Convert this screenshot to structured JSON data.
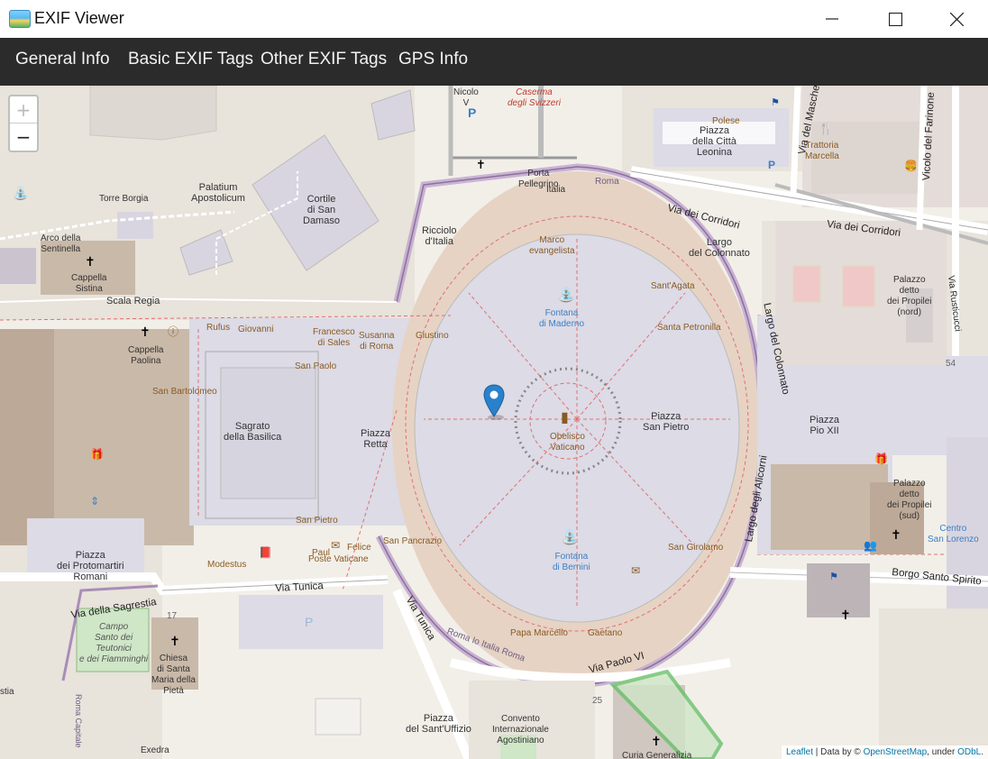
{
  "window": {
    "title": "EXIF Viewer",
    "minimize_label": "",
    "maximize_label": "",
    "close_label": ""
  },
  "tabs": [
    {
      "label": "General Info"
    },
    {
      "label": "Basic EXIF Tags"
    },
    {
      "label": "Other EXIF Tags"
    },
    {
      "label": "GPS Info"
    }
  ],
  "map": {
    "zoom_in": "+",
    "zoom_out": "−",
    "attribution": {
      "leaflet": "Leaflet",
      "sep": " | Data by © ",
      "osm": "OpenStreetMap",
      "under": ", under ",
      "license": "ODbL",
      "end": "."
    },
    "labels": {
      "nicolo": "Nicolo\nV",
      "caserma": "Caserma\ndegli Svizzeri",
      "porta": "Porta\nPellegrino",
      "italia_top": "Italia",
      "roma_top": "Roma",
      "torre_borgia": "Torre Borgia",
      "palatium": "Palatium\nApostolicum",
      "cortile": "Cortile\ndi San\nDamaso",
      "arco": "Arco della\nSentinella",
      "cappella_sistina": "Cappella\nSistina",
      "scala_regia": "Scala Regia",
      "ricciolo": "Ricciolo\nd'Italia",
      "marco": "Marco\nevangelista",
      "santagata": "Sant'Agata",
      "santa_petronilla": "Santa Petronilla",
      "fontana_maderno": "Fontana\ndi Maderno",
      "rufus": "Rufus",
      "giovanni": "Giovanni",
      "francesco": "Francesco\ndi Sales",
      "susanna": "Susanna\ndi Roma",
      "giustino": "Giustino",
      "cappella_paolina": "Cappella\nPaolina",
      "san_paolo": "San Paolo",
      "san_bartolomeo": "San Bartolomeo",
      "sagrato": "Sagrato\ndella Basilica",
      "piazza_retta": "Piazza\nRetta",
      "obelisco": "Obelisco\nVaticano",
      "piazza_san_pietro": "Piazza\nSan Pietro",
      "piazza_pio": "Piazza\nPio XII",
      "san_pietro_lower": "San Pietro",
      "piazza_protomartiri": "Piazza\ndei Protomartiri\nRomani",
      "modestus": "Modestus",
      "paul": "Paul",
      "poste": "Poste Vaticane",
      "felice": "Felice",
      "san_pancrazio": "San Pancrazio",
      "fontana_bernini": "Fontana\ndi Bernini",
      "san_girolamo": "San Girolamo",
      "papa_marcello": "Papa Marcello",
      "gaetano": "Gaetano",
      "via_sagrestia": "Via della Sagrestia",
      "via_tunica": "Via Tunica",
      "via_tunica2": "Via Tunica",
      "campo_santo": "Campo\nSanto dei\nTeutonici\ne dei Fiamminghi",
      "chiesa_pieta": "Chiesa\ndi Santa\nMaria della\nPietà",
      "num17": "17",
      "piazza_santuffizio": "Piazza\ndel Sant'Uffizio",
      "convento": "Convento\nInternazionale\nAgostiniano",
      "curia": "Curia Generalizia",
      "exedra": "Exedra",
      "roma_capitale": "Roma Capitale",
      "stia": "stia",
      "num25": "25",
      "roma_io_italia_roma": "Roma  Io  Italia  Roma",
      "via_paolo_vi": "Via Paolo VI",
      "piazza_citta": "Piazza\ndella Città\nLeonina",
      "polese": "Polese",
      "trattoria": "Trattoria\nMarcella",
      "via_del_masche": "Via del Masche",
      "vicolo_farinone": "Vicolo del Farinone",
      "via_corridori1": "Via dei Corridori",
      "via_corridori2": "Via dei Corridori",
      "largo_colonnato": "Largo\ndel Colonnato",
      "largo_colonnato_v": "Largo del Colonnato",
      "largo_alicorni": "Largo degli Alicorni",
      "palazzo_nord": "Palazzo\ndetto\ndei Propilei\n(nord)",
      "palazzo_sud": "Palazzo\ndetto\ndei Propilei\n(sud)",
      "via_rusticucci": "Via Rusticucci",
      "num54": "54",
      "borgo_santo_spirito": "Borgo Santo Spirito",
      "centro_lorenzo": "Centro\nSan Lorenzo",
      "italia_mid": "Italia"
    }
  }
}
